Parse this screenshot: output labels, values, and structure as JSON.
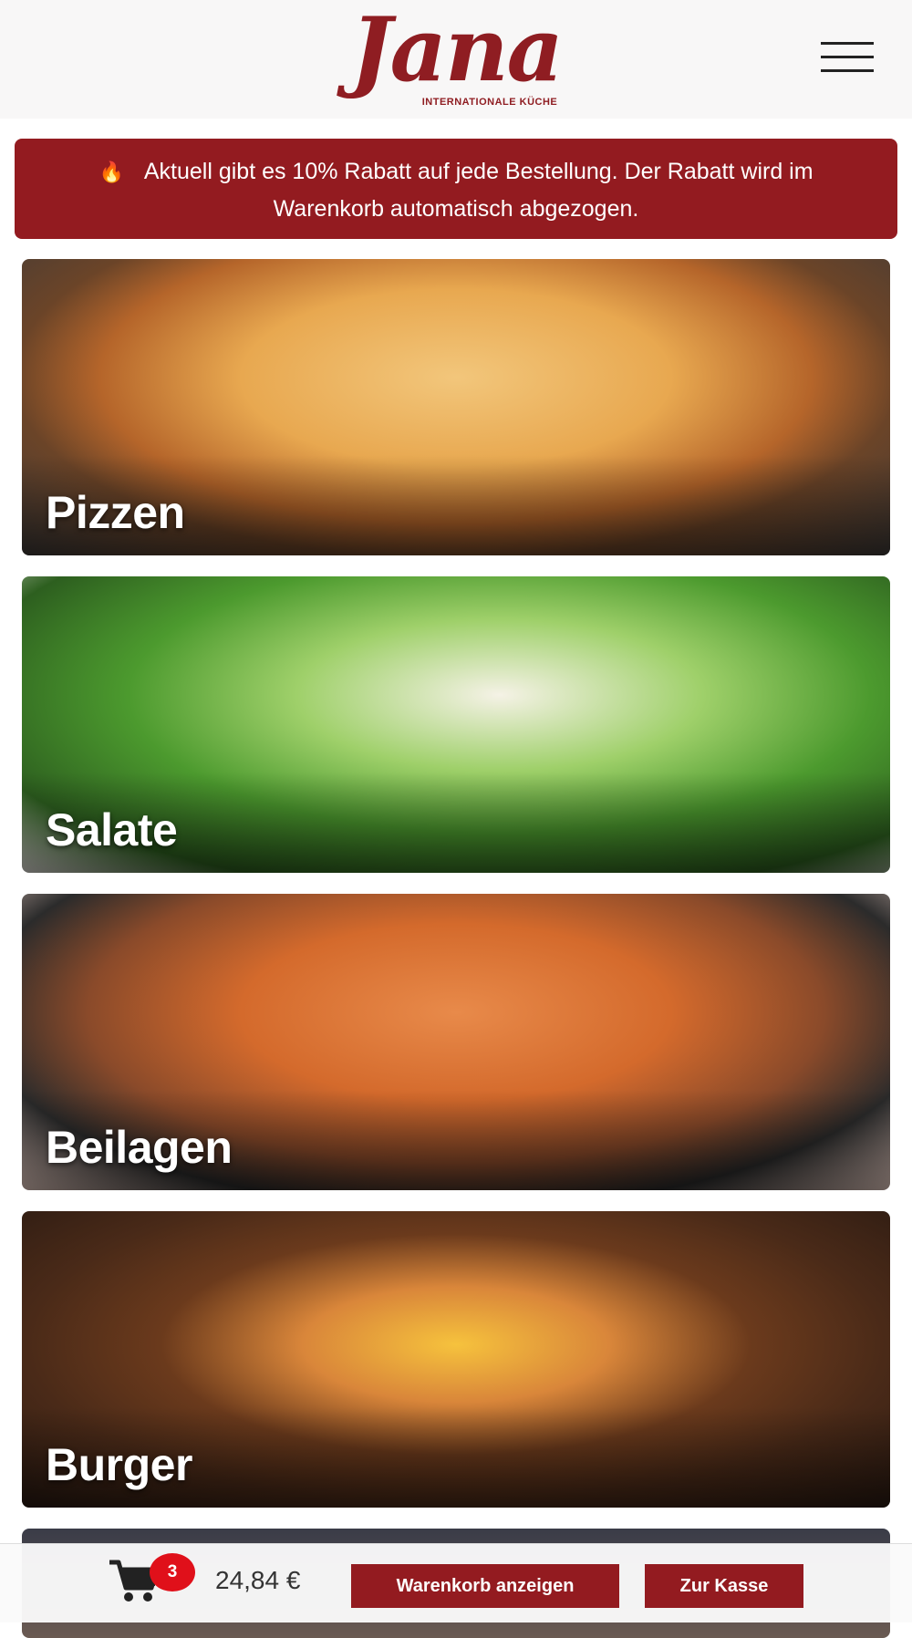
{
  "header": {
    "logo_text": "Jana",
    "logo_subtitle": "INTERNATIONALE KÜCHE",
    "menu_icon": "hamburger-menu-icon"
  },
  "promo": {
    "icon": "fire-icon",
    "text": "Aktuell gibt es 10% Rabatt auf jede Bestellung. Der Rabatt wird im Warenkorb automatisch abgezogen."
  },
  "categories": [
    {
      "label": "Pizzen"
    },
    {
      "label": "Salate"
    },
    {
      "label": "Beilagen"
    },
    {
      "label": "Burger"
    }
  ],
  "cart": {
    "icon": "shopping-cart-icon",
    "count": "3",
    "total": "24,84 €",
    "view_cart_label": "Warenkorb anzeigen",
    "checkout_label": "Zur Kasse"
  },
  "colors": {
    "brand": "#931b20",
    "badge": "#e0101a"
  }
}
